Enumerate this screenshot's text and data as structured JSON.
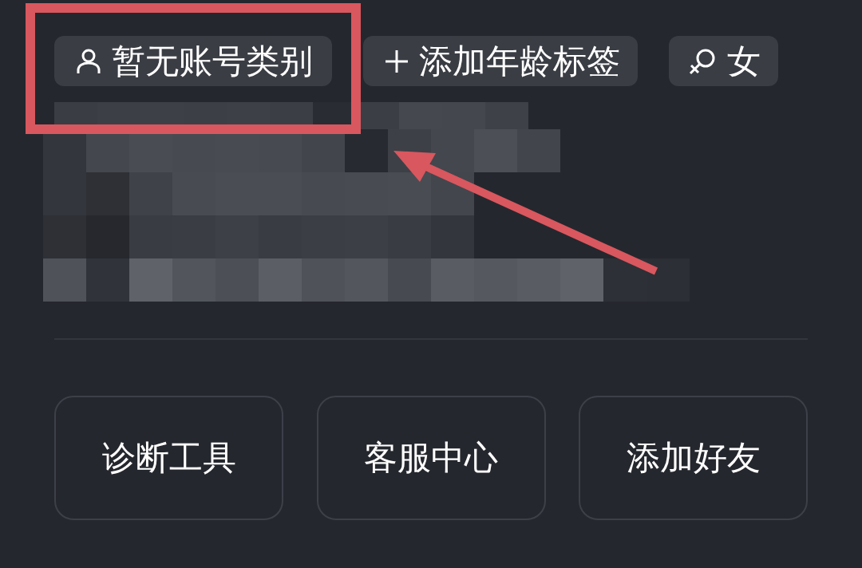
{
  "tags": [
    {
      "kind": "account",
      "label": "暂无账号类别"
    },
    {
      "kind": "add",
      "label": "添加年龄标签"
    },
    {
      "kind": "female",
      "label": "女"
    }
  ],
  "buttons": [
    {
      "label": "诊断工具"
    },
    {
      "label": "客服中心"
    },
    {
      "label": "添加好友"
    }
  ]
}
